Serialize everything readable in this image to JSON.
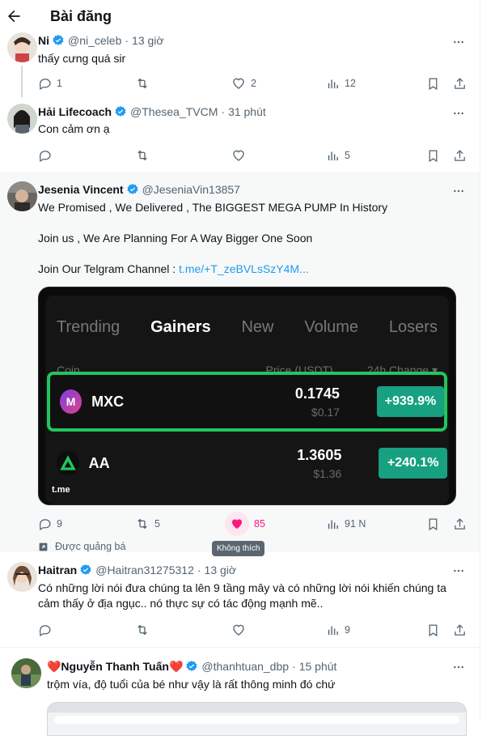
{
  "header": {
    "title": "Bài đăng"
  },
  "tweets": [
    {
      "name": "Ni",
      "handle": "@ni_celeb",
      "sep": "·",
      "time": "13 giờ",
      "text": "thấy cưng quá sir",
      "replies": "1",
      "retweets": "",
      "likes": "2",
      "views": "12"
    },
    {
      "name": "Hải Lifecoach",
      "handle": "@Thesea_TVCM",
      "sep": "·",
      "time": "31 phút",
      "text": "Con cảm ơn ạ",
      "replies": "",
      "retweets": "",
      "likes": "",
      "views": "5"
    },
    {
      "name": "Jesenia Vincent",
      "handle": "@JeseniaVin13857",
      "line1": "We Promised , We Delivered ,  The BIGGEST MEGA PUMP In History",
      "line2": "Join us , We Are Planning For A Way Bigger One Soon",
      "line3": "Join Our Telgram  Channel : ",
      "link": "t.me/+T_zeBVLsSzY4M...",
      "replies": "9",
      "retweets": "5",
      "likes": "85",
      "views": "91 N",
      "tooltip": "Không thích",
      "promoted": "Được quảng bá",
      "card": {
        "tabs": [
          "Trending",
          "Gainers",
          "New",
          "Volume",
          "Losers"
        ],
        "col_coin": "Coin",
        "col_price": "Price (USDT)",
        "col_change": "24h Change ▾",
        "rows": [
          {
            "coin": "MXC",
            "price": "0.1745",
            "usd": "$0.17",
            "change": "+939.9%"
          },
          {
            "coin": "AA",
            "price": "1.3605",
            "usd": "$1.36",
            "change": "+240.1%"
          }
        ],
        "source": "t.me",
        "accent": "#17a181"
      }
    },
    {
      "name": "Haitran",
      "handle": "@Haitran31275312",
      "sep": "·",
      "time": "13 giờ",
      "text": "Có những lời nói đưa chúng ta lên 9 tầng mây và có những lời nói khiến chúng ta cảm thấy ở địa ngục.. nó thực sự có tác động mạnh mẽ..",
      "replies": "",
      "retweets": "",
      "likes": "",
      "views": "9"
    },
    {
      "name": "❤️Nguyễn Thanh Tuấn❤️",
      "handle": "@thanhtuan_dbp",
      "sep": "·",
      "time": "15 phút",
      "text": "trộm vía, độ tuổi của bé như vậy là rất thông minh đó chứ"
    }
  ],
  "colors": {
    "like_pink": "#f91880",
    "verified_blue": "#1d9bf0",
    "link": "#1d9bf0"
  }
}
